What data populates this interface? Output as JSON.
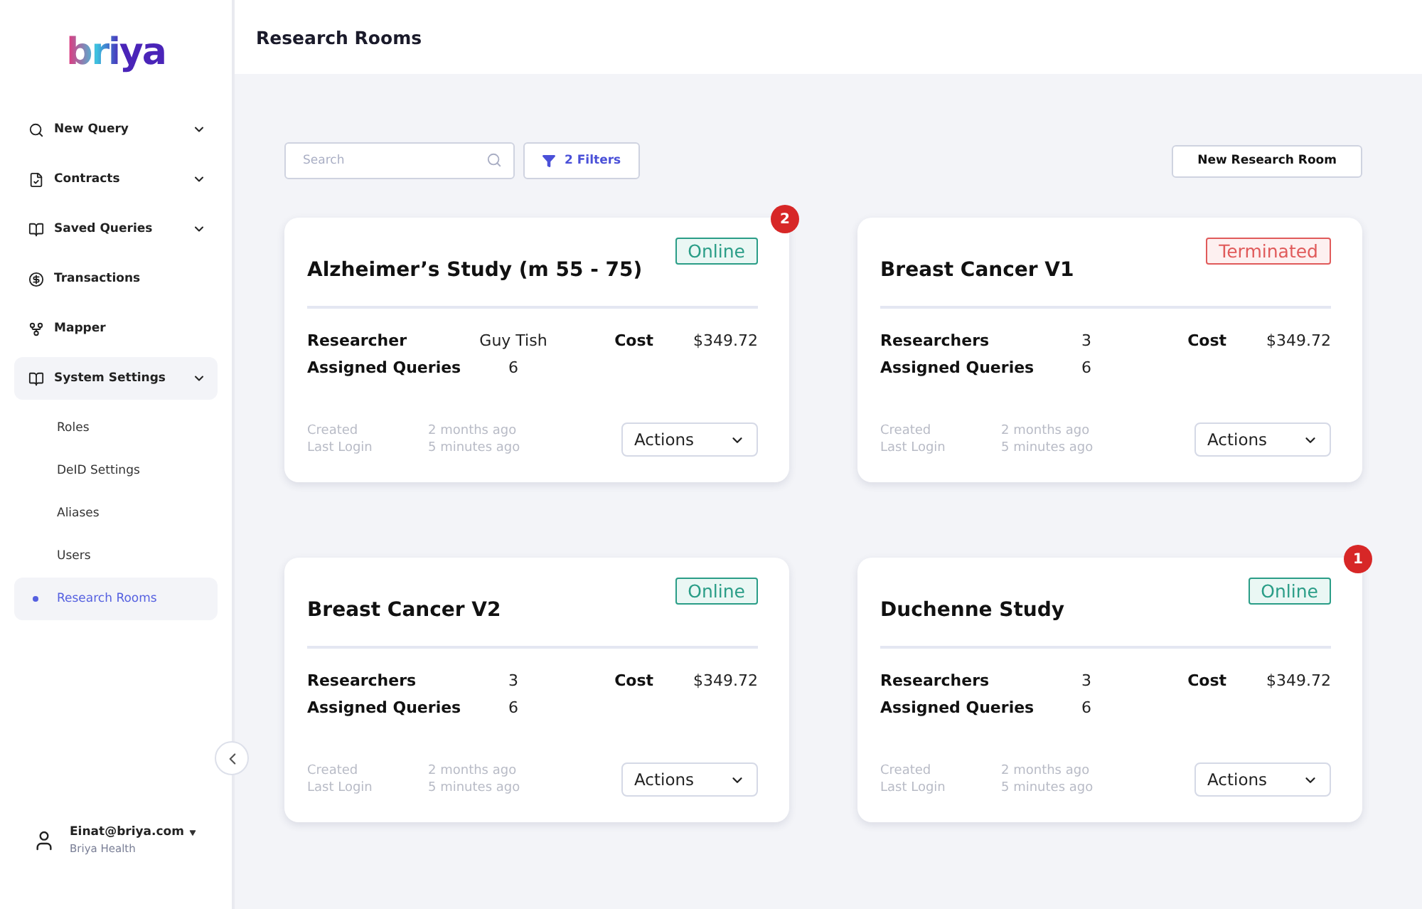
{
  "logo": "briya",
  "sidebar": {
    "items": [
      {
        "label": "New Query",
        "expandable": true,
        "selected": false
      },
      {
        "label": "Contracts",
        "expandable": true,
        "selected": false
      },
      {
        "label": "Saved Queries",
        "expandable": true,
        "selected": false
      },
      {
        "label": "Transactions",
        "expandable": false,
        "selected": false
      },
      {
        "label": "Mapper",
        "expandable": false,
        "selected": false
      },
      {
        "label": "System Settings",
        "expandable": true,
        "selected": true,
        "children": [
          {
            "label": "Roles",
            "selected": false
          },
          {
            "label": "DeID Settings",
            "selected": false
          },
          {
            "label": "Aliases",
            "selected": false
          },
          {
            "label": "Users",
            "selected": false
          },
          {
            "label": "Research Rooms",
            "selected": true
          }
        ]
      }
    ]
  },
  "user": {
    "email": "Einat@briya.com",
    "org": "Briya Health"
  },
  "header": {
    "title": "Research Rooms"
  },
  "toolbar": {
    "search": {
      "placeholder": "Search"
    },
    "filters": "2 Filters",
    "new_button": "New Research Room"
  },
  "cards": [
    {
      "title": "Alzheimer’s Study (m 55 - 75)",
      "status": {
        "label": "Online",
        "kind": "online"
      },
      "badge": "2",
      "researchers_label": "Researcher",
      "researchers": "Guy Tish",
      "queries_label": "Assigned Queries",
      "queries": "6",
      "cost_label": "Cost",
      "cost": "$349.72",
      "created_label": "Created",
      "created": "2 months ago",
      "login_label": "Last Login",
      "login": "5 minutes ago",
      "actions": "Actions"
    },
    {
      "title": "Breast Cancer V1",
      "status": {
        "label": "Terminated",
        "kind": "terminated"
      },
      "researchers_label": "Researchers",
      "researchers": "3",
      "queries_label": "Assigned Queries",
      "queries": "6",
      "cost_label": "Cost",
      "cost": "$349.72",
      "created_label": "Created",
      "created": "2 months ago",
      "login_label": "Last Login",
      "login": "5 minutes ago",
      "actions": "Actions"
    },
    {
      "title": "Breast Cancer V2",
      "status": {
        "label": "Online",
        "kind": "online"
      },
      "researchers_label": "Researchers",
      "researchers": "3",
      "queries_label": "Assigned Queries",
      "queries": "6",
      "cost_label": "Cost",
      "cost": "$349.72",
      "created_label": "Created",
      "created": "2 months ago",
      "login_label": "Last Login",
      "login": "5 minutes ago",
      "actions": "Actions"
    },
    {
      "title": "Duchenne Study",
      "status": {
        "label": "Online",
        "kind": "online"
      },
      "badge": "1",
      "researchers_label": "Researchers",
      "researchers": "3",
      "queries_label": "Assigned Queries",
      "queries": "6",
      "cost_label": "Cost",
      "cost": "$349.72",
      "created_label": "Created",
      "created": "2 months ago",
      "login_label": "Last Login",
      "login": "5 minutes ago",
      "actions": "Actions"
    }
  ]
}
